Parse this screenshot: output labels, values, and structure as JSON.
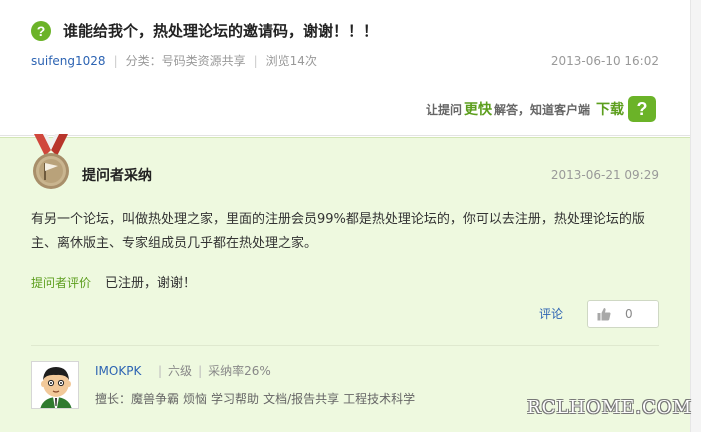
{
  "question": {
    "icon": "?",
    "title": "谁能给我个，热处理论坛的邀请码，谢谢！！！",
    "author": "suifeng1028",
    "category": "分类：号码类资源共享",
    "views": "浏览14次",
    "date": "2013-06-10 16:02"
  },
  "promo": {
    "pre": "让提问",
    "highlight": "更快",
    "post": "解答，知道客户端",
    "download": "下载",
    "icon": "?"
  },
  "answer": {
    "medal_icon": "medal-icon",
    "title": "提问者采纳",
    "date": "2013-06-21 09:29",
    "body": "有另一个论坛，叫做热处理之家，里面的注册会员99%都是热处理论坛的，你可以去注册，热处理论坛的版主、离休版主、专家组成员几乎都在热处理之家。",
    "eval_label": "提问者评价",
    "eval_text": "已注册，谢谢！",
    "comment_label": "评论",
    "like_count": "0"
  },
  "answerer": {
    "name": "IMOKPK",
    "level": "六级",
    "accept_rate": "采纳率26%",
    "expert_label": "擅长：",
    "expert_items": [
      "魔兽争霸",
      "烦恼",
      "学习帮助",
      "文档/报告共享",
      "工程技术科学"
    ]
  },
  "watermark": "RCLHOME.COM",
  "colors": {
    "green": "#6bb328",
    "link": "#2d64b3",
    "answer_bg": "#eef9df"
  }
}
